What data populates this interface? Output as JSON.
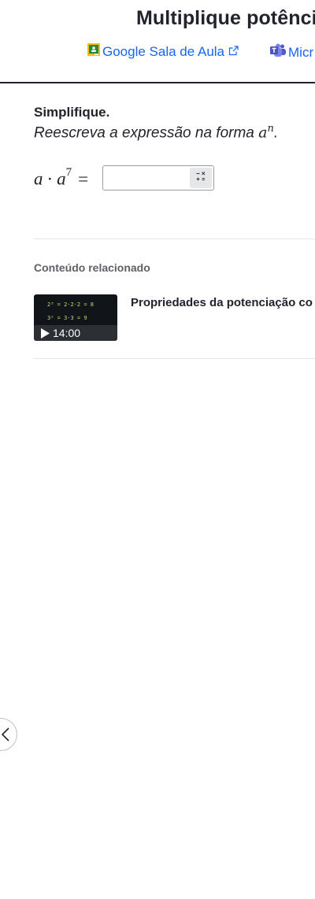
{
  "header": {
    "title": "Multiplique potênci",
    "share_classroom": "Google Sala de Aula",
    "share_teams": "Micr"
  },
  "problem": {
    "heading": "Simplifique.",
    "instruction_text": "Reescreva a expressão na forma ",
    "instruction_base": "a",
    "instruction_exp": "n",
    "instruction_end": ".",
    "expr_base1": "a",
    "expr_op": "·",
    "expr_base2": "a",
    "expr_exp2": "7",
    "expr_equals": "=",
    "answer_value": ""
  },
  "related": {
    "label": "Conteúdo relacionado",
    "video": {
      "title": "Propriedades da potenciação co",
      "duration": "14:00",
      "thumb_line1": "2³ = 2·2·2 = 8",
      "thumb_line2": "3² = 3·3 = 9"
    }
  },
  "colors": {
    "accent": "#1865f2",
    "text": "#21242c",
    "muted": "#5f6167"
  }
}
